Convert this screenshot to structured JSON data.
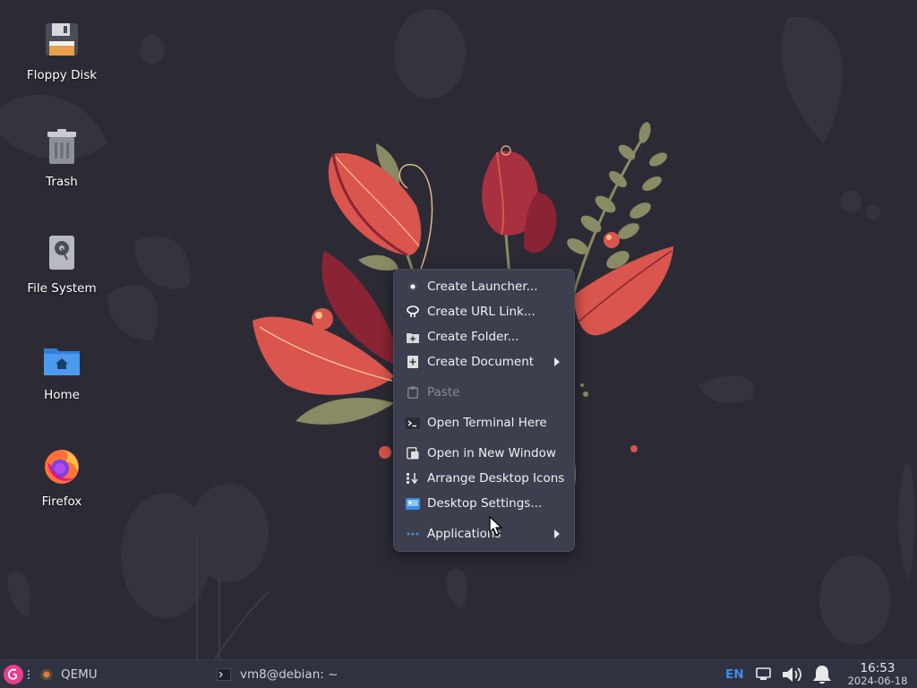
{
  "desktop": {
    "icons": [
      {
        "label": "Floppy Disk",
        "icon": "floppy-disk-icon"
      },
      {
        "label": "Trash",
        "icon": "trash-icon"
      },
      {
        "label": "File System",
        "icon": "hard-drive-icon"
      },
      {
        "label": "Home",
        "icon": "home-folder-icon"
      },
      {
        "label": "Firefox",
        "icon": "firefox-icon"
      }
    ]
  },
  "context_menu": {
    "items": [
      {
        "label": "Create Launcher...",
        "icon": "launcher-icon",
        "disabled": false,
        "submenu": false
      },
      {
        "label": "Create URL Link...",
        "icon": "link-icon",
        "disabled": false,
        "submenu": false
      },
      {
        "label": "Create Folder...",
        "icon": "new-folder-icon",
        "disabled": false,
        "submenu": false
      },
      {
        "label": "Create Document",
        "icon": "new-document-icon",
        "disabled": false,
        "submenu": true
      },
      {
        "label": "Paste",
        "icon": "paste-icon",
        "disabled": true,
        "submenu": false
      },
      {
        "label": "Open Terminal Here",
        "icon": "terminal-icon",
        "disabled": false,
        "submenu": false
      },
      {
        "label": "Open in New Window",
        "icon": "new-window-icon",
        "disabled": false,
        "submenu": false
      },
      {
        "label": "Arrange Desktop Icons",
        "icon": "arrange-icon",
        "disabled": false,
        "submenu": false
      },
      {
        "label": "Desktop Settings...",
        "icon": "desktop-settings-icon",
        "disabled": false,
        "submenu": false
      },
      {
        "label": "Applications",
        "icon": "applications-icon",
        "disabled": false,
        "submenu": true
      }
    ]
  },
  "taskbar": {
    "start_icon": "debian-swirl-icon",
    "tasks": [
      {
        "label": "QEMU",
        "icon": "qemu-icon"
      },
      {
        "label": "vm8@debian: ~",
        "icon": "terminal-icon"
      }
    ],
    "keyboard_layout": "EN",
    "clock_time": "16:53",
    "clock_date": "2024-06-18"
  },
  "colors": {
    "desktop_bg": "#2c2b35",
    "menu_bg": "#3b3f4e",
    "taskbar_bg": "#2f3240",
    "accent_blue": "#3d8ee0",
    "flower_red": "#d9554e",
    "flower_dark": "#8a2434",
    "leaf_olive": "#8a8a64"
  }
}
